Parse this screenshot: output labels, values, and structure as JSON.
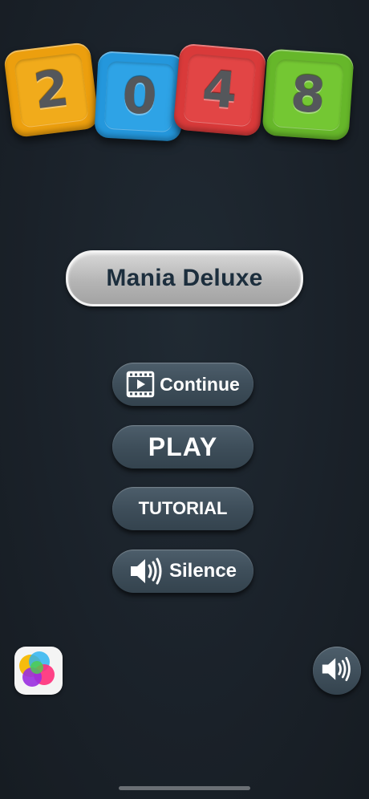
{
  "logo": {
    "tiles": [
      {
        "digit": "2",
        "color": "#ec9f0e"
      },
      {
        "digit": "0",
        "color": "#2497dc"
      },
      {
        "digit": "4",
        "color": "#d93a3a"
      },
      {
        "digit": "8",
        "color": "#66b72a"
      }
    ]
  },
  "mode": {
    "label": "Mania Deluxe"
  },
  "menu": {
    "continue_label": "Continue",
    "continue_icon": "film-play-icon",
    "play_label": "PLAY",
    "tutorial_label": "TUTORIAL",
    "silence_label": "Silence",
    "silence_icon": "speaker-icon"
  },
  "bottom": {
    "left_icon": "game-center-icon",
    "right_icon": "sound-on-icon"
  },
  "colors": {
    "background": "#1a2129",
    "button": "#3e4e5a",
    "badge_text": "#1c2e3d"
  }
}
